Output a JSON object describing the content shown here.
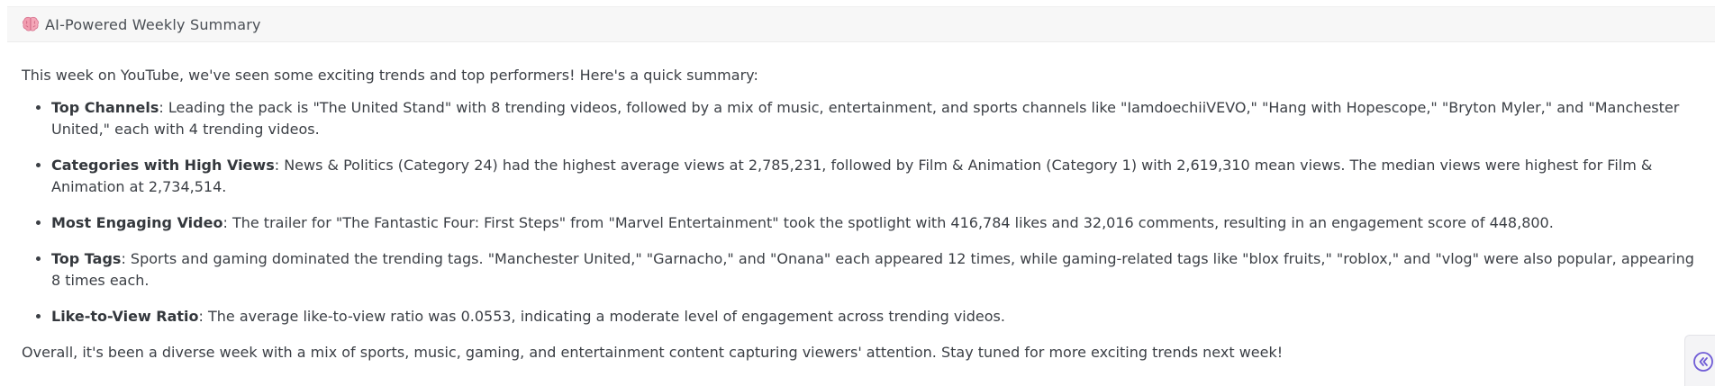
{
  "header": {
    "icon": "brain-icon",
    "title": "AI-Powered Weekly Summary"
  },
  "summary": {
    "intro": "This week on YouTube, we've seen some exciting trends and top performers! Here's a quick summary:",
    "items": [
      {
        "label": "Top Channels",
        "text": ": Leading the pack is \"The United Stand\" with 8 trending videos, followed by a mix of music, entertainment, and sports channels like \"IamdoechiiVEVO,\" \"Hang with Hopescope,\" \"Bryton Myler,\" and \"Manchester United,\" each with 4 trending videos."
      },
      {
        "label": "Categories with High Views",
        "text": ": News & Politics (Category 24) had the highest average views at 2,785,231, followed by Film & Animation (Category 1) with 2,619,310 mean views. The median views were highest for Film & Animation at 2,734,514."
      },
      {
        "label": "Most Engaging Video",
        "text": ": The trailer for \"The Fantastic Four: First Steps\" from \"Marvel Entertainment\" took the spotlight with 416,784 likes and 32,016 comments, resulting in an engagement score of 448,800."
      },
      {
        "label": "Top Tags",
        "text": ": Sports and gaming dominated the trending tags. \"Manchester United,\" \"Garnacho,\" and \"Onana\" each appeared 12 times, while gaming-related tags like \"blox fruits,\" \"roblox,\" and \"vlog\" were also popular, appearing 8 times each."
      },
      {
        "label": "Like-to-View Ratio",
        "text": ": The average like-to-view ratio was 0.0553, indicating a moderate level of engagement across trending videos."
      }
    ],
    "outro": "Overall, it's been a diverse week with a mix of sports, music, gaming, and entertainment content capturing viewers' attention. Stay tuned for more exciting trends next week!"
  },
  "collapse_button": {
    "icon": "double-chevron-left-icon",
    "color": "#6f5bd6"
  }
}
